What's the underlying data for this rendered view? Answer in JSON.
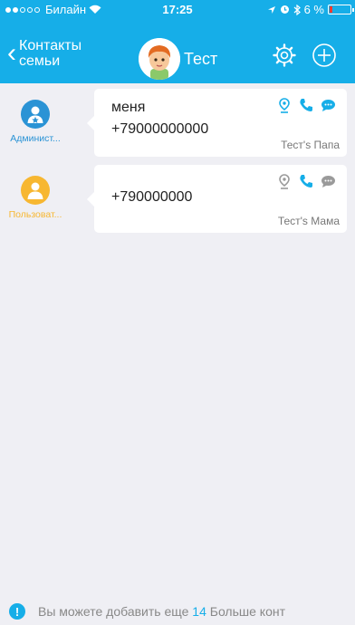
{
  "status_bar": {
    "carrier": "Билайн",
    "time": "17:25",
    "battery": "6 %"
  },
  "nav": {
    "back_label_line1": "Контакты",
    "back_label_line2": "семьи",
    "title": "Тест"
  },
  "contacts": [
    {
      "role": "Админист...",
      "role_color": "#2a93d5",
      "name": "меня",
      "phone": "+79000000000",
      "relation": "Тест's Папа",
      "location_color": "#16aee8"
    },
    {
      "role": "Пользоват...",
      "role_color": "#f7b731",
      "name": "",
      "phone": "+790000000",
      "relation": "Тест's Мама",
      "location_color": "#9a9a9a"
    }
  ],
  "footer": {
    "prefix": "Вы можете добавить еще",
    "count": "14",
    "suffix": "Больше конт"
  },
  "colors": {
    "accent": "#16aee8",
    "background": "#efeff4"
  },
  "icons": {
    "back": "chevron-left-icon",
    "settings": "gear-icon",
    "add": "plus-circle-icon",
    "location": "location-pin-icon",
    "call": "phone-icon",
    "chat": "chat-bubble-icon",
    "info": "info-icon"
  }
}
